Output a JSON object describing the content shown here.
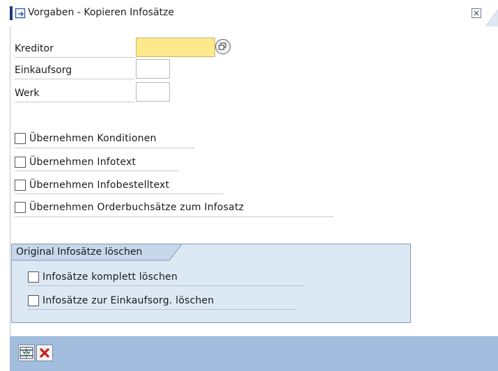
{
  "window": {
    "title": "Vorgaben - Kopieren Infosätze",
    "close_icon": "close-icon"
  },
  "fields": {
    "kreditor": {
      "label": "Kreditor",
      "value": "",
      "required": true
    },
    "einkaufsorg": {
      "label": "Einkaufsorg",
      "value": ""
    },
    "werk": {
      "label": "Werk",
      "value": ""
    }
  },
  "options": [
    {
      "label": "Übernehmen Konditionen",
      "checked": false
    },
    {
      "label": "Übernehmen Infotext",
      "checked": false
    },
    {
      "label": "Übernehmen Infobestelltext",
      "checked": false
    },
    {
      "label": "Übernehmen Orderbuchsätze zum Infosatz",
      "checked": false
    }
  ],
  "group": {
    "title": "Original Infosätze löschen",
    "options": [
      {
        "label": "Infosätze komplett löschen",
        "checked": false
      },
      {
        "label": "Infosätze zur Einkaufsorg. löschen",
        "checked": false
      }
    ]
  },
  "footer": {
    "buttons": [
      {
        "name": "execute",
        "icon": "execute-icon"
      },
      {
        "name": "cancel",
        "icon": "cancel-icon"
      }
    ]
  },
  "colors": {
    "required_field": "#fde98b",
    "group_background": "#dce8f3",
    "footer_background": "#a2bddd",
    "title_accent": "#1e3a78",
    "cancel_red": "#d11a1a"
  }
}
